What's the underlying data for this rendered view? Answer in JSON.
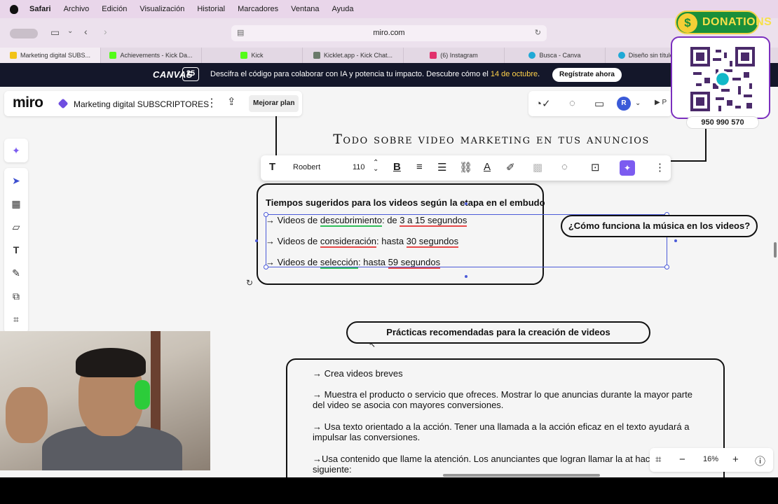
{
  "menubar": {
    "app": "Safari",
    "items": [
      "Archivo",
      "Edición",
      "Visualización",
      "Historial",
      "Marcadores",
      "Ventana",
      "Ayuda"
    ]
  },
  "browser": {
    "url": "miro.com",
    "tabs": [
      {
        "label": "Marketing digital SUBS...",
        "color": "#f2c318"
      },
      {
        "label": "Achievements - Kick Da...",
        "color": "#53fc18"
      },
      {
        "label": "Kick",
        "color": "#53fc18"
      },
      {
        "label": "Kicklet.app - Kick Chat...",
        "color": "#6a7a6a"
      },
      {
        "label": "(6) Instagram",
        "color": "#e1306c"
      },
      {
        "label": "Busca - Canva",
        "color": "#1fa9d6"
      },
      {
        "label": "Diseño sin título - Anun",
        "color": "#1fa9d6"
      }
    ]
  },
  "banner": {
    "logo": "CANVAS",
    "logo_num": "25",
    "message": "Descifra el código para colaborar con IA y potencia tu impacto. Descubre cómo el ",
    "date": "14 de octubre",
    "message_end": ".",
    "cta": "Regístrate ahora"
  },
  "miro": {
    "brand": "miro",
    "board_name": "Marketing digital SUBSCRIPTORES",
    "upgrade": "Mejorar plan",
    "avatar": "R",
    "present_short": "P"
  },
  "format_toolbar": {
    "font": "Roobert",
    "size": "110"
  },
  "board": {
    "title": "Todo sobre video marketing en tus anuncios",
    "box1": {
      "heading": "Tiempos sugeridos para los videos según la etapa en el embudo",
      "lines": [
        {
          "prefix": "→ Videos de ",
          "u1": "descubrimiento",
          "mid": ": de ",
          "u2": "3 a 15 segundos"
        },
        {
          "prefix": "→ Videos de ",
          "u1": "consideración",
          "mid": ": hasta ",
          "u2": "30 segundos"
        },
        {
          "prefix": "→ Videos de ",
          "u1": "selección",
          "mid": ": hasta ",
          "u2": "59 segundos"
        }
      ]
    },
    "question": "¿Cómo funciona la música en los videos?",
    "practices_title": "Prácticas recomendadas para la creación de videos",
    "practices": [
      "→ Crea videos breves",
      "→ Muestra el producto o servicio que ofreces. Mostrar lo que anuncias durante la mayor parte del video se asocia con mayores conversiones.",
      "→ Usa texto orientado a la acción. Tener una llamada a la acción eficaz en el texto ayudará a impulsar las conversiones.",
      "→Usa contenido que llame la atención. Los anunciantes que logran llamar la at hacer lo siguiente:"
    ]
  },
  "zoom": {
    "value": "16%"
  },
  "donations": {
    "label": "DONATIONS",
    "coin": "$",
    "phone": "950 990 570"
  }
}
